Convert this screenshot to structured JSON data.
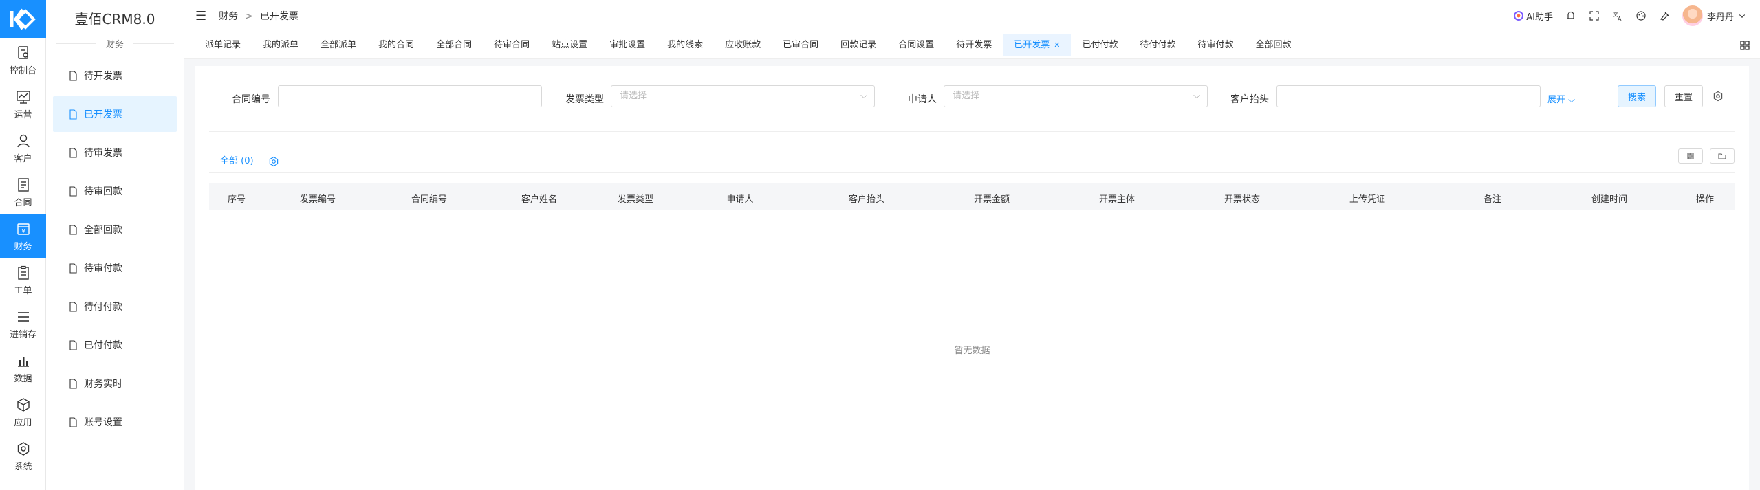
{
  "rail": {
    "items": [
      {
        "label": "控制台",
        "icon": "dashboard-icon"
      },
      {
        "label": "运营",
        "icon": "operations-icon"
      },
      {
        "label": "客户",
        "icon": "customer-icon"
      },
      {
        "label": "合同",
        "icon": "contract-icon"
      },
      {
        "label": "财务",
        "icon": "finance-icon",
        "active": true
      },
      {
        "label": "工单",
        "icon": "workorder-icon"
      },
      {
        "label": "进销存",
        "icon": "inventory-icon"
      },
      {
        "label": "数据",
        "icon": "data-icon"
      },
      {
        "label": "应用",
        "icon": "app-icon"
      },
      {
        "label": "系统",
        "icon": "system-icon"
      }
    ]
  },
  "submenu": {
    "title": "壹佰CRM8.0",
    "group": "财务",
    "items": [
      {
        "label": "待开发票"
      },
      {
        "label": "已开发票",
        "active": true
      },
      {
        "label": "待审发票"
      },
      {
        "label": "待审回款"
      },
      {
        "label": "全部回款"
      },
      {
        "label": "待审付款"
      },
      {
        "label": "待付付款"
      },
      {
        "label": "已付付款"
      },
      {
        "label": "财务实时"
      },
      {
        "label": "账号设置"
      }
    ]
  },
  "header": {
    "breadcrumb": [
      "财务",
      "已开发票"
    ],
    "breadcrumb_sep": ">",
    "ai_label": "AI助手",
    "user_name": "李丹丹"
  },
  "tabs": [
    {
      "label": "派单记录"
    },
    {
      "label": "我的派单"
    },
    {
      "label": "全部派单"
    },
    {
      "label": "我的合同"
    },
    {
      "label": "全部合同"
    },
    {
      "label": "待审合同"
    },
    {
      "label": "站点设置"
    },
    {
      "label": "审批设置"
    },
    {
      "label": "我的线索"
    },
    {
      "label": "应收账款"
    },
    {
      "label": "已审合同"
    },
    {
      "label": "回款记录"
    },
    {
      "label": "合同设置"
    },
    {
      "label": "待开发票"
    },
    {
      "label": "已开发票",
      "active": true,
      "closable": true
    },
    {
      "label": "已付付款"
    },
    {
      "label": "待付付款"
    },
    {
      "label": "待审付款"
    },
    {
      "label": "全部回款"
    }
  ],
  "filters": {
    "contract_no_label": "合同编号",
    "contract_no_value": "",
    "invoice_type_label": "发票类型",
    "invoice_type_placeholder": "请选择",
    "applicant_label": "申请人",
    "applicant_placeholder": "请选择",
    "customer_title_label": "客户抬头",
    "customer_title_value": "",
    "expand_label": "展开",
    "search_label": "搜索",
    "reset_label": "重置"
  },
  "list": {
    "tab_all_label": "全部 (0)",
    "columns": [
      "序号",
      "发票编号",
      "合同编号",
      "客户姓名",
      "发票类型",
      "申请人",
      "客户抬头",
      "开票金额",
      "开票主体",
      "开票状态",
      "上传凭证",
      "备注",
      "创建时间",
      "操作"
    ],
    "empty_text": "暂无数据"
  },
  "colors": {
    "accent": "#1890ff"
  }
}
